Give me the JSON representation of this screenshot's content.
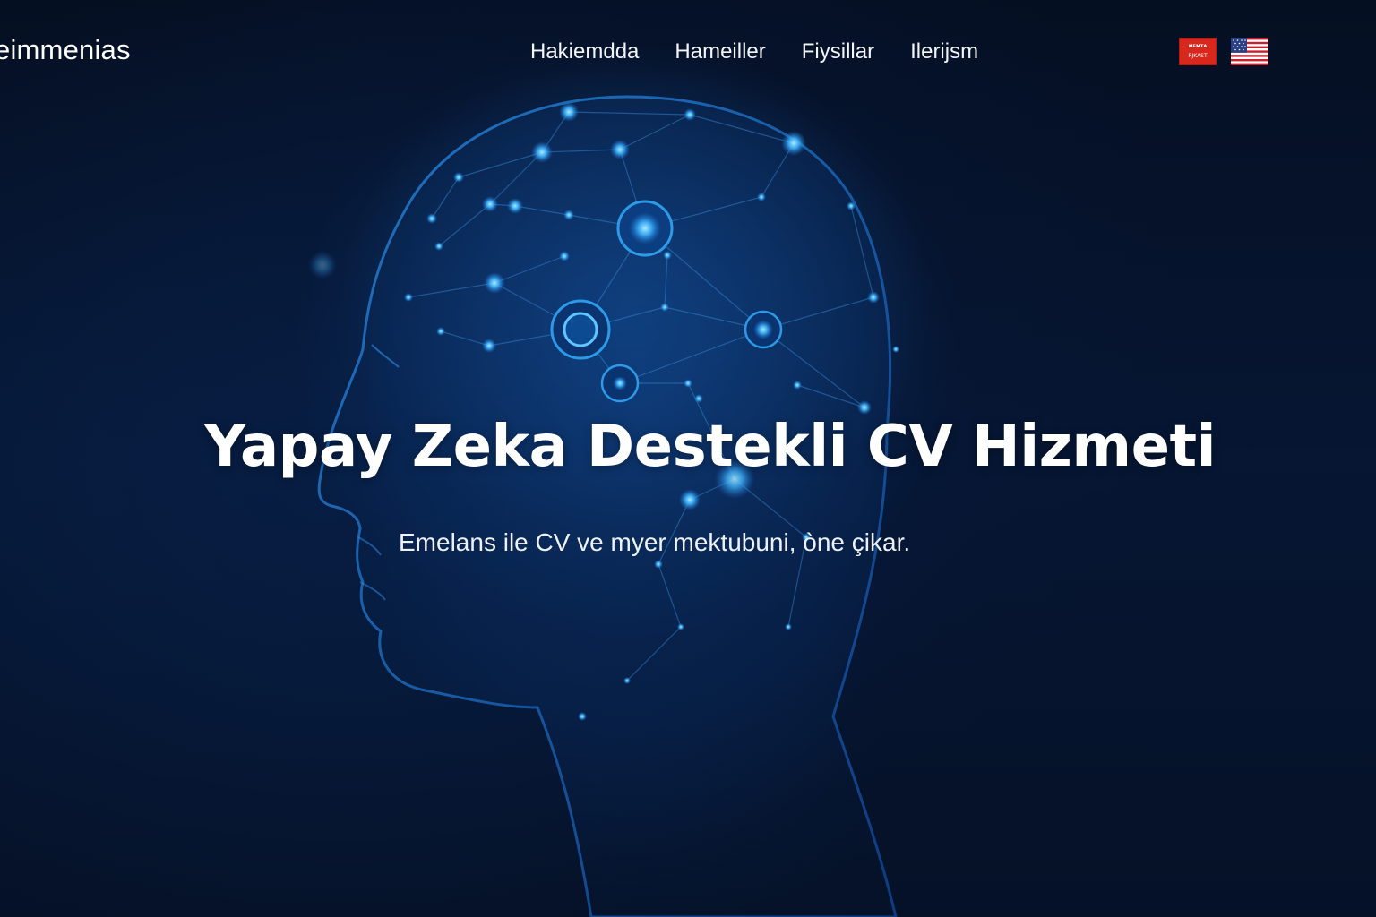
{
  "brand": {
    "logo_text": "eimmenias"
  },
  "nav": {
    "items": [
      {
        "label": "Hakiemdda"
      },
      {
        "label": "Hameiller"
      },
      {
        "label": "Fiysillar"
      },
      {
        "label": "Ilerijsm"
      }
    ]
  },
  "language_switcher": {
    "turkish_flag_text_top": "ᴍᴇᴍᴛᴀ",
    "turkish_flag_text_bottom": "RJKASТ",
    "options": [
      {
        "icon": "turkish-flag-icon",
        "color": "#d8281e"
      },
      {
        "icon": "us-flag-icon"
      }
    ]
  },
  "hero": {
    "title": "Yapay Zeka Destekli CV Hizmeti",
    "subtitle": "Emelans ile CV ve myer mektubuni, òne çikar."
  },
  "colors": {
    "background": "#040d1e",
    "accent_glow": "#3fb6ff",
    "text": "#ffffff"
  }
}
